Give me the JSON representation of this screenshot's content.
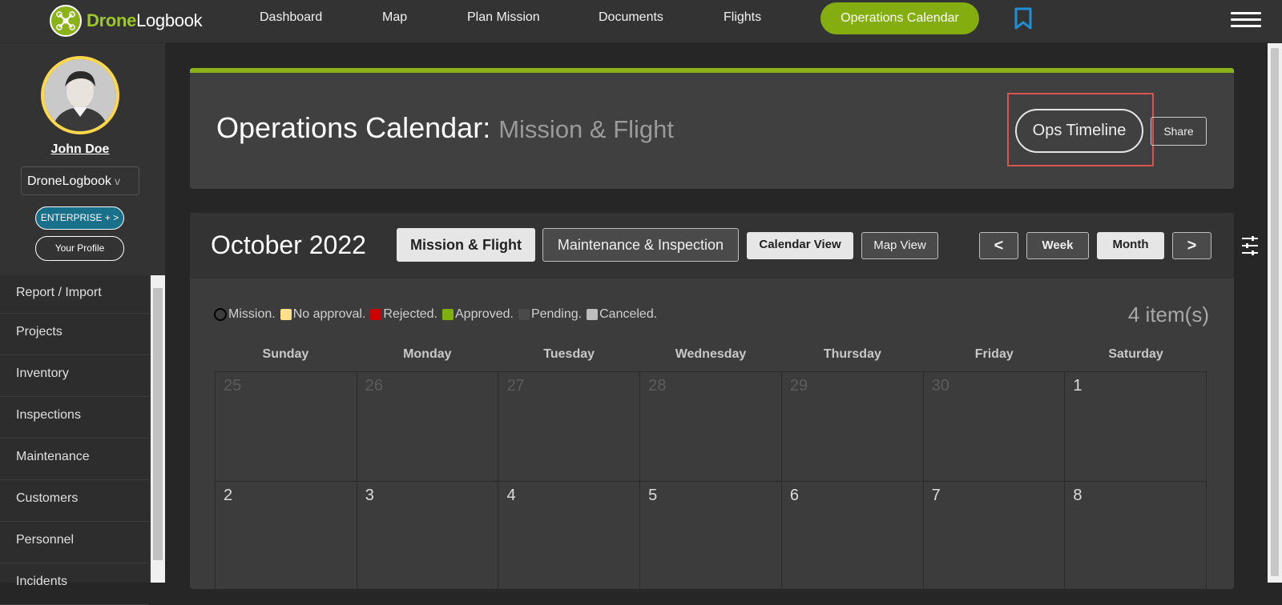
{
  "brand": {
    "part1": "Drone",
    "part2": "Logbook"
  },
  "nav": {
    "items": [
      "Dashboard",
      "Map",
      "Plan Mission",
      "Documents",
      "Flights"
    ],
    "active": "Operations Calendar"
  },
  "user": {
    "name": "John Doe",
    "org": "DroneLogbook",
    "org_chevron": "v",
    "plan": "ENTERPRISE + >",
    "profile": "Your Profile"
  },
  "sidebar": {
    "items": [
      "Report / Import",
      "Projects",
      "Inventory",
      "Inspections",
      "Maintenance",
      "Customers",
      "Personnel",
      "Incidents"
    ]
  },
  "header": {
    "title": "Operations Calendar:",
    "subtitle": "Mission & Flight",
    "ops_timeline": "Ops Timeline",
    "share": "Share"
  },
  "calendar": {
    "month": "October 2022",
    "tabs": {
      "mission": "Mission & Flight",
      "maintenance": "Maintenance & Inspection"
    },
    "views": {
      "calendar": "Calendar View",
      "map": "Map View"
    },
    "nav": {
      "prev": "<",
      "week": "Week",
      "month": "Month",
      "next": ">"
    },
    "legend": [
      {
        "label": "Mission.",
        "color": "ring"
      },
      {
        "label": "No approval.",
        "color": "#ffe08a"
      },
      {
        "label": "Rejected.",
        "color": "#cc0000"
      },
      {
        "label": "Approved.",
        "color": "#7fb10d"
      },
      {
        "label": "Pending.",
        "color": "#4a4a4a"
      },
      {
        "label": "Canceled.",
        "color": "#bdbdbd"
      }
    ],
    "count": "4 item(s)",
    "days_of_week": [
      "Sunday",
      "Monday",
      "Tuesday",
      "Wednesday",
      "Thursday",
      "Friday",
      "Saturday"
    ],
    "weeks": [
      [
        "25",
        "26",
        "27",
        "28",
        "29",
        "30",
        "1"
      ],
      [
        "2",
        "3",
        "4",
        "5",
        "6",
        "7",
        "8"
      ]
    ]
  },
  "colors": {
    "accent": "#8cb21a",
    "highlight": "#d9534f",
    "enterprise": "#19708a"
  }
}
